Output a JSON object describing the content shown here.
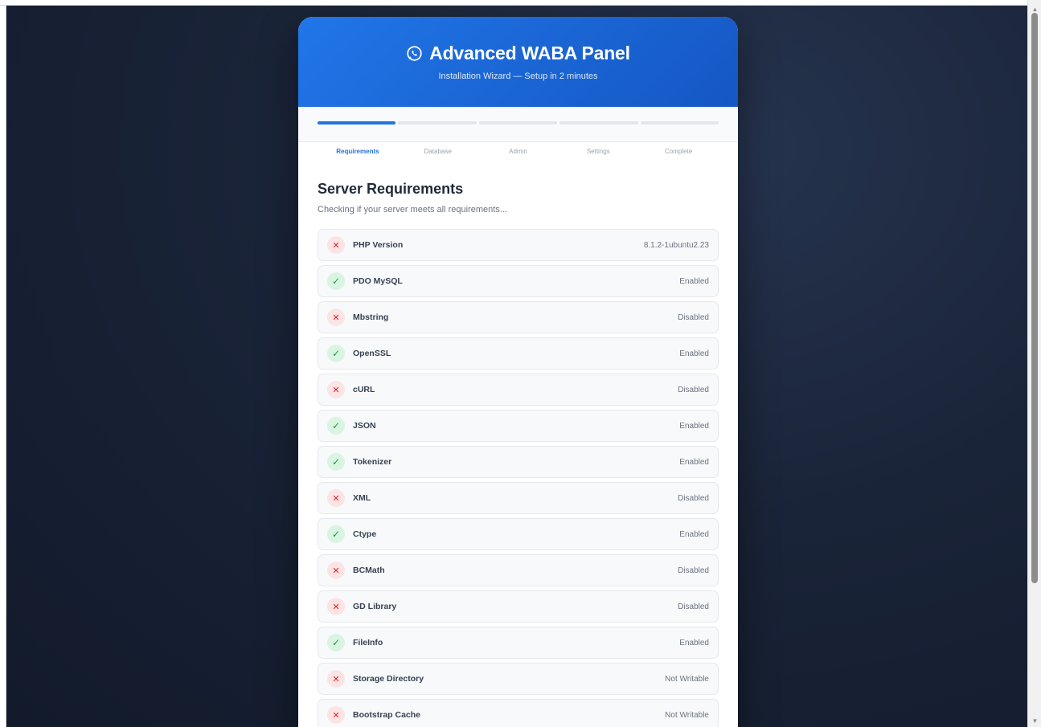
{
  "header": {
    "title": "Advanced WABA Panel",
    "subtitle": "Installation Wizard — Setup in 2 minutes",
    "icon": "whatsapp-icon"
  },
  "steps": [
    {
      "label": "Requirements",
      "active": true
    },
    {
      "label": "Database",
      "active": false
    },
    {
      "label": "Admin",
      "active": false
    },
    {
      "label": "Settings",
      "active": false
    },
    {
      "label": "Complete",
      "active": false
    }
  ],
  "section": {
    "title": "Server Requirements",
    "subtitle": "Checking if your server meets all requirements..."
  },
  "requirements": [
    {
      "name": "PHP Version",
      "value": "8.1.2-1ubuntu2.23",
      "ok": false
    },
    {
      "name": "PDO MySQL",
      "value": "Enabled",
      "ok": true
    },
    {
      "name": "Mbstring",
      "value": "Disabled",
      "ok": false
    },
    {
      "name": "OpenSSL",
      "value": "Enabled",
      "ok": true
    },
    {
      "name": "cURL",
      "value": "Disabled",
      "ok": false
    },
    {
      "name": "JSON",
      "value": "Enabled",
      "ok": true
    },
    {
      "name": "Tokenizer",
      "value": "Enabled",
      "ok": true
    },
    {
      "name": "XML",
      "value": "Disabled",
      "ok": false
    },
    {
      "name": "Ctype",
      "value": "Enabled",
      "ok": true
    },
    {
      "name": "BCMath",
      "value": "Disabled",
      "ok": false
    },
    {
      "name": "GD Library",
      "value": "Disabled",
      "ok": false
    },
    {
      "name": "FileInfo",
      "value": "Enabled",
      "ok": true
    },
    {
      "name": "Storage Directory",
      "value": "Not Writable",
      "ok": false
    },
    {
      "name": "Bootstrap Cache",
      "value": "Not Writable",
      "ok": false
    }
  ],
  "colors": {
    "accent": "#2374e1",
    "ok": "#1f9d4b",
    "fail": "#e02424"
  }
}
